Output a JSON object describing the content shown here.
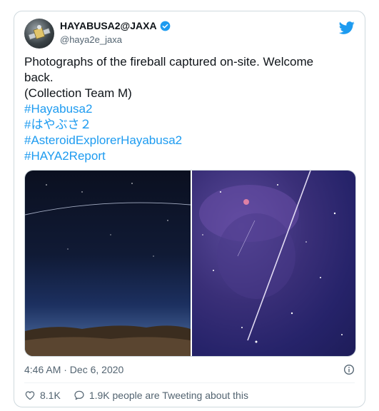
{
  "author": {
    "display_name": "HAYABUSA2@JAXA",
    "handle": "@haya2e_jaxa",
    "verified": true
  },
  "tweet": {
    "text_lines": [
      "Photographs of the fireball captured on-site. Welcome",
      "back.",
      "(Collection Team M)"
    ],
    "hashtags": [
      "#Hayabusa2",
      "#はやぶさ２",
      "#AsteroidExplorerHayabusa2",
      "#HAYA2Report"
    ],
    "timestamp": "4:46 AM · Dec 6, 2020"
  },
  "engagement": {
    "likes": "8.1K",
    "conversation": "1.9K people are Tweeting about this"
  },
  "icons": [
    "avatar",
    "verified-badge-icon",
    "twitter-bird-icon",
    "info-icon",
    "heart-icon",
    "speech-bubble-icon"
  ],
  "colors": {
    "link": "#1d9bf0",
    "secondary_text": "#536471",
    "primary_text": "#0f1419",
    "border": "#cfd9de"
  }
}
